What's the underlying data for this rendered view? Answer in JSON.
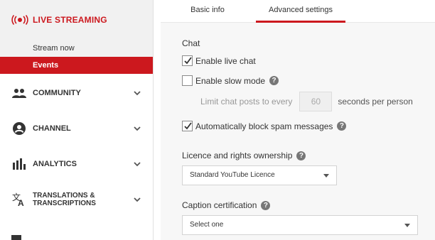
{
  "sidebar": {
    "live_title": "LIVE STREAMING",
    "sub_items": [
      {
        "label": "Stream now"
      },
      {
        "label": "Events"
      }
    ],
    "nav_items": [
      {
        "label": "COMMUNITY",
        "icon": "people-icon"
      },
      {
        "label": "CHANNEL",
        "icon": "account-icon"
      },
      {
        "label": "ANALYTICS",
        "icon": "bar-chart-icon"
      },
      {
        "label": "TRANSLATIONS & TRANSCRIPTIONS",
        "icon": "translate-icon"
      }
    ],
    "accent": "#cc181e"
  },
  "tabs": {
    "basic": "Basic info",
    "advanced": "Advanced settings"
  },
  "chat": {
    "title": "Chat",
    "enable_live_chat": {
      "label": "Enable live chat",
      "checked": true
    },
    "enable_slow_mode": {
      "label": "Enable slow mode",
      "checked": false
    },
    "limit_prefix": "Limit chat posts to every",
    "limit_value": "60",
    "limit_suffix": "seconds per person",
    "block_spam": {
      "label": "Automatically block spam messages",
      "checked": true
    }
  },
  "licence": {
    "title": "Licence and rights ownership",
    "value": "Standard YouTube Licence"
  },
  "caption": {
    "title": "Caption certification",
    "value": "Select one"
  }
}
